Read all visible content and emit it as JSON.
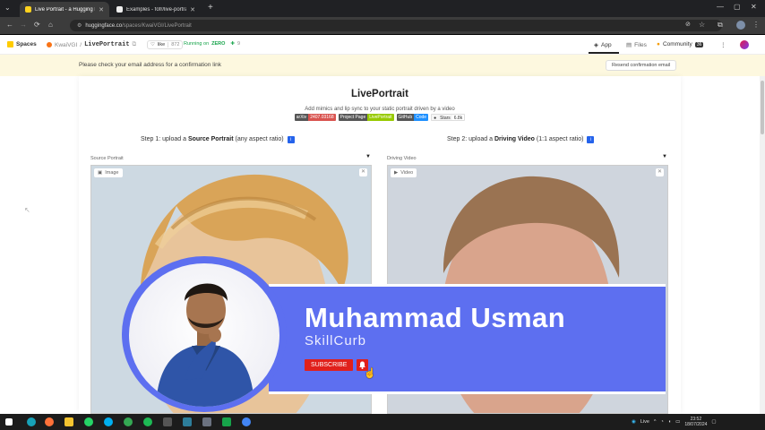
{
  "browser": {
    "tabs": [
      {
        "title": "Live Portrait - a Hugging Face S",
        "active": true
      },
      {
        "title": "Examples - fofr/live-portrait - R",
        "active": false
      }
    ],
    "url_host": "huggingface.co",
    "url_path": "/spaces/KwaiVGI/LivePortrait"
  },
  "hf_nav": {
    "spaces_label": "Spaces",
    "org": "KwaiVGI",
    "repo": "LivePortrait",
    "like_label": "like",
    "like_count": "872",
    "running_label": "Running on",
    "running_hw": "ZERO",
    "tabs": [
      {
        "label": "App",
        "icon": "app-icon",
        "active": true
      },
      {
        "label": "Files",
        "icon": "files-icon",
        "active": false
      },
      {
        "label": "Community",
        "icon": "community-icon",
        "badge": "36",
        "active": false
      }
    ]
  },
  "banner": {
    "message": "Please check your email address for a confirmation link",
    "button": "Resend confirmation email"
  },
  "app": {
    "title": "LivePortrait",
    "subtitle": "Add mimics and lip sync to your static portrait driven by a video",
    "badges": [
      {
        "left": "arXiv",
        "right": "2407.03168",
        "color": "#d9534f"
      },
      {
        "left": "Project Page",
        "right": "LivePortrait",
        "color": "#97ca00"
      },
      {
        "left": "GitHub",
        "right": "Code",
        "color": "#1e90ff"
      },
      {
        "left": "Stars",
        "right": "6.8k",
        "color": "#eeeeee"
      }
    ],
    "step1": {
      "prefix": "Step 1: upload a",
      "bold": "Source Portrait",
      "suffix": "(any aspect ratio)"
    },
    "step2": {
      "prefix": "Step 2: upload a",
      "bold": "Driving Video",
      "suffix": "(1:1 aspect ratio)"
    },
    "source_label": "Source Portrait",
    "driving_label": "Driving Video",
    "image_tag": "Image",
    "video_tag": "Video"
  },
  "overlay": {
    "name": "Muhammad Usman",
    "brand": "SkillCurb",
    "subscribe": "SUBSCRIBE",
    "accent": "#5d6ff0"
  },
  "taskbar": {
    "live_label": "Live",
    "time": "23:52",
    "date": "18/07/2024"
  }
}
